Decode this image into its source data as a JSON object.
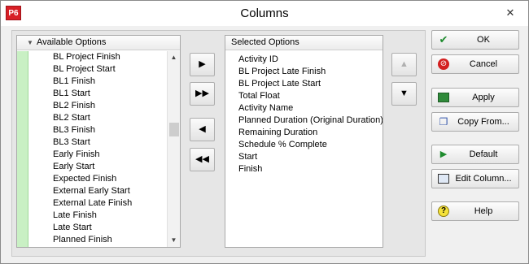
{
  "window": {
    "title": "Columns",
    "app_icon_text": "P6",
    "close_glyph": "✕"
  },
  "available": {
    "header": "Available Options",
    "items": [
      "BL Project Finish",
      "BL Project Start",
      "BL1 Finish",
      "BL1 Start",
      "BL2 Finish",
      "BL2 Start",
      "BL3 Finish",
      "BL3 Start",
      "Early Finish",
      "Early Start",
      "Expected Finish",
      "External Early Start",
      "External Late Finish",
      "Late Finish",
      "Late Start",
      "Planned Finish"
    ]
  },
  "selected": {
    "header": "Selected Options",
    "items": [
      "Activity ID",
      "BL Project Late Finish",
      "BL Project Late Start",
      "Total Float",
      "Activity Name",
      "Planned Duration  (Original Duration)",
      "Remaining Duration",
      "Schedule % Complete",
      "Start",
      "Finish"
    ]
  },
  "transfer": {
    "add_glyph": "▶",
    "add_all_glyph": "▶▶",
    "remove_glyph": "◀",
    "remove_all_glyph": "◀◀",
    "up_glyph": "▲",
    "down_glyph": "▼"
  },
  "buttons": {
    "ok": "OK",
    "cancel": "Cancel",
    "apply": "Apply",
    "copy_from": "Copy From...",
    "default": "Default",
    "edit_column": "Edit Column...",
    "help": "Help"
  },
  "icons": {
    "ok": "checkmark-icon",
    "cancel": "no-entry-icon",
    "apply": "apply-icon",
    "copy_from": "copy-icon",
    "default": "play-icon",
    "edit_column": "edit-column-icon",
    "help": "help-icon"
  },
  "colors": {
    "app_icon": "#d81f26",
    "available_stripe": "#c9f0c4",
    "ok_icon": "#1e8b2e",
    "cancel_icon": "#d32020"
  }
}
